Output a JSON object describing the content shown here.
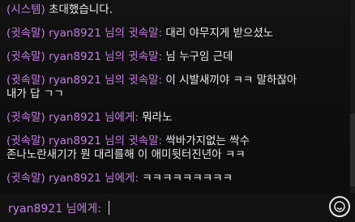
{
  "chat": {
    "system_message": {
      "tag": "(시스템)",
      "text": "초대했습니다."
    },
    "messages": [
      {
        "tag": "(귓속말)",
        "sender": "ryan8921",
        "mid": "님의 귓속말:",
        "text": "대리 야무지게 받으셨노"
      },
      {
        "tag": "(귓속말)",
        "sender": "ryan8921",
        "mid": "님의 귓속말:",
        "text": "님 누구임 근데"
      },
      {
        "tag": "(귓속말)",
        "sender": "ryan8921",
        "mid": "님의 귓속말:",
        "text": "이 시발새끼야 ㅋㅋ 말하잖아\n내가 답 ㄱㄱ"
      },
      {
        "tag": "(귓속말)",
        "sender": "ryan8921",
        "mid": "님에게:",
        "text": "뭐라노"
      },
      {
        "tag": "(귓속말)",
        "sender": "ryan8921",
        "mid": "님의 귓속말:",
        "text": "싹바가지없는 싹수\n존나노란새기가 뭔 대리를해 이 애미뒷터진년아 ㅋㅋ"
      },
      {
        "tag": "(귓속말)",
        "sender": "ryan8921",
        "mid": "님에게:",
        "text": "ㅋㅋㅋㅋㅋㅋㅋㅋㅋ"
      }
    ]
  },
  "input": {
    "label": "ryan8921 님에게:",
    "value": ""
  },
  "colors": {
    "whisper": "#c77de6",
    "text": "#ececec",
    "background": "#0d0d0d"
  },
  "icons": {
    "emoji_button": "emoji-icon"
  }
}
